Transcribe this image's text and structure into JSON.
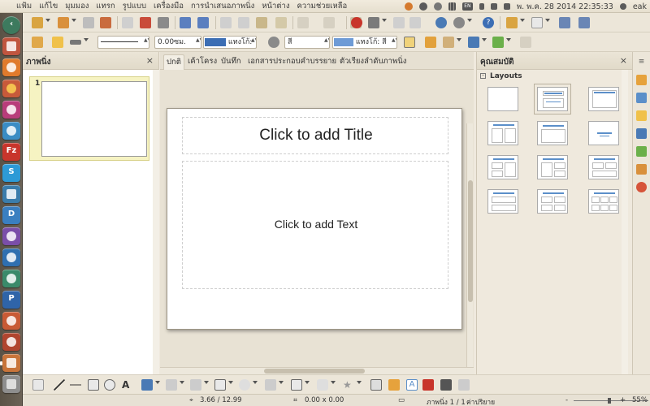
{
  "top_menu": [
    "แฟ้ม",
    "แก้ไข",
    "มุมมอง",
    "แทรก",
    "รูปแบบ",
    "เครื่องมือ",
    "การนำเสนอภาพนิ่ง",
    "หน้าต่าง",
    "ความช่วยเหลือ"
  ],
  "indicators": {
    "keyboard": "EN",
    "clock": "พ. พ.ค. 28 2014 22:35:33",
    "user": "eak"
  },
  "toolbar2": {
    "line_width": "0.00ซม.",
    "line_color_label": "แทงโก้:",
    "area_style": "สี",
    "area_color_label": "แทงโก้: สี"
  },
  "slides_pane": {
    "title": "ภาพนิ่ง",
    "close": "×",
    "slide_number": "1"
  },
  "tabs": [
    "ปกติ",
    "เค้าโครง",
    "บันทึก",
    "เอกสารประกอบคำบรรยาย",
    "ตัวเรียงลำดับภาพนิ่ง"
  ],
  "slide": {
    "title_placeholder": "Click to add Title",
    "text_placeholder": "Click to add Text"
  },
  "properties_pane": {
    "title": "คุณสมบัติ",
    "close": "×",
    "section": "Layouts",
    "selected_layout": 1
  },
  "status": {
    "position": "3.66 / 12.99",
    "size": "0.00 x 0.00",
    "slide": "ภาพนิ่ง 1 / 1",
    "master": "ค่าปริยาย",
    "zoom_minus": "-",
    "zoom_plus": "+",
    "zoom": "55%"
  },
  "colors": {
    "accent_blue": "#3c6eb4",
    "launcher_bg": "#5a5246",
    "panel_bg": "#efe9dd"
  }
}
